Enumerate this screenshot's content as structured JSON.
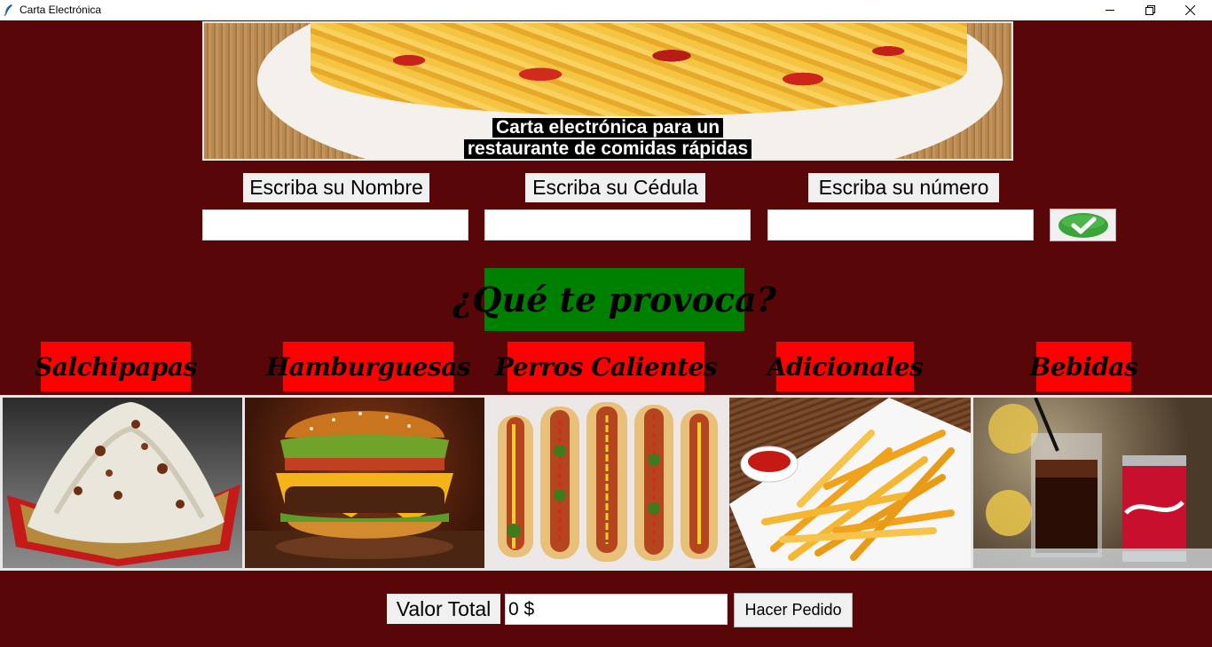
{
  "window": {
    "title": "Carta Electrónica",
    "icon": "feather-icon"
  },
  "banner": {
    "caption_line1": "Carta electrónica para un",
    "caption_line2": "restaurante de comidas rápidas"
  },
  "form": {
    "name_label": "Escriba su Nombre",
    "id_label": "Escriba su Cédula",
    "phone_label": "Escriba su número",
    "name_value": "",
    "id_value": "",
    "phone_value": "",
    "confirm_icon": "checkmark-icon"
  },
  "question": "¿Qué te provoca?",
  "categories": [
    {
      "label": "Salchipapas"
    },
    {
      "label": "Hamburguesas"
    },
    {
      "label": "Perros Calientes"
    },
    {
      "label": "Adicionales"
    },
    {
      "label": "Bebidas"
    }
  ],
  "footer": {
    "total_label": "Valor Total",
    "total_value": "0 $",
    "order_button": "Hacer Pedido"
  },
  "colors": {
    "background": "#580607",
    "question_bg": "#008000",
    "category_bg": "#ff0000"
  }
}
